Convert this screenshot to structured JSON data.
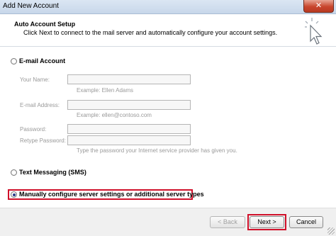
{
  "window": {
    "title": "Add New Account",
    "close_glyph": "✕"
  },
  "header": {
    "title": "Auto Account Setup",
    "subtitle": "Click Next to connect to the mail server and automatically configure your account settings.",
    "icon": "cursor-click-icon"
  },
  "email_account": {
    "label": "E-mail Account",
    "selected": false,
    "fields": {
      "name_label": "Your Name:",
      "name_value": "",
      "name_hint": "Example: Ellen Adams",
      "email_label": "E-mail Address:",
      "email_value": "",
      "email_hint": "Example: ellen@contoso.com",
      "password_label": "Password:",
      "password_value": "",
      "retype_label": "Retype Password:",
      "retype_value": "",
      "password_hint": "Type the password your Internet service provider has given you."
    }
  },
  "sms": {
    "label": "Text Messaging (SMS)",
    "selected": false
  },
  "manual": {
    "label": "Manually configure server settings or additional server types",
    "selected": true
  },
  "footer": {
    "back_label": "< Back",
    "next_label": "Next >",
    "cancel_label": "Cancel"
  },
  "colors": {
    "highlight": "#d0102a",
    "title_bar": "#c7d7ea",
    "close_button": "#c8462d"
  }
}
